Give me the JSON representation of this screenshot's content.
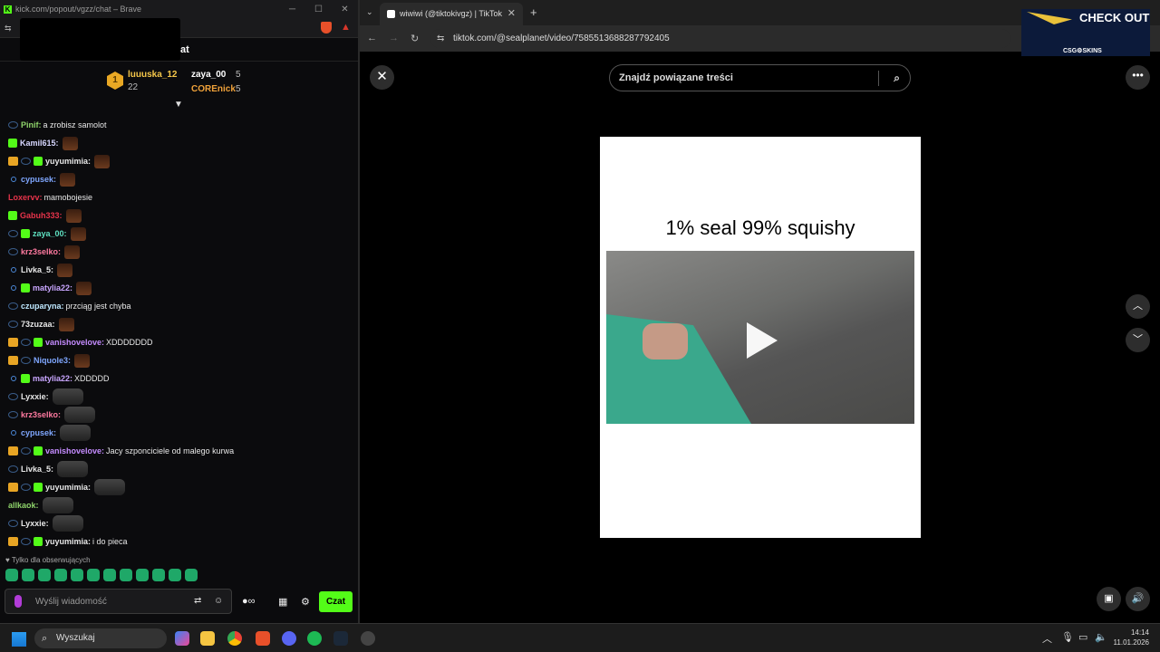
{
  "kick_window": {
    "title": "kick.com/popout/vgzz/chat – Brave",
    "chat_title_suffix": "at",
    "leaderboard": {
      "rank": "1",
      "first_user": "luuuska_12",
      "first_count": "22",
      "second_user": "zaya_00",
      "second_count": "5",
      "third_user": "COREnick",
      "third_count": "5"
    },
    "messages": [
      {
        "user": "Pinif",
        "color": "#8fd46b",
        "text": "a zrobisz samolot",
        "badges": [
          "sub"
        ]
      },
      {
        "user": "Kamil615",
        "color": "#d7d7ff",
        "text": "",
        "badges": [
          "green"
        ],
        "emote": true
      },
      {
        "user": "yuyumimia",
        "color": "#e8e8e8",
        "text": "",
        "badges": [
          "crown",
          "sub",
          "green"
        ],
        "emote": true
      },
      {
        "user": "cypusek",
        "color": "#7fa7ff",
        "text": "",
        "badges": [
          "dot"
        ],
        "emote": true
      },
      {
        "user": "Loxervv",
        "color": "#e6334a",
        "text": "mamobojesie",
        "badges": []
      },
      {
        "user": "Gabuh333",
        "color": "#e6334a",
        "text": "",
        "badges": [
          "green"
        ],
        "emote": true
      },
      {
        "user": "zaya_00",
        "color": "#5ee0c1",
        "text": "",
        "badges": [
          "sub",
          "green"
        ],
        "emote": true
      },
      {
        "user": "krz3selko",
        "color": "#ff7aa0",
        "text": "",
        "badges": [
          "sub"
        ],
        "emote": true
      },
      {
        "user": "Livka_5",
        "color": "#e8e8e8",
        "text": "",
        "badges": [
          "dot"
        ],
        "emote": true
      },
      {
        "user": "matylia22",
        "color": "#c9a6ff",
        "text": "",
        "badges": [
          "dot",
          "green"
        ],
        "emote": true
      },
      {
        "user": "czuparyna",
        "color": "#bfe8ff",
        "text": "przciąg jest chyba",
        "badges": [
          "sub"
        ]
      },
      {
        "user": "73zuzaa",
        "color": "#e8e8e8",
        "text": "",
        "badges": [
          "sub"
        ],
        "emote": true
      },
      {
        "user": "vanishovelove",
        "color": "#c58cff",
        "text": "XDDDDDDD",
        "badges": [
          "crown",
          "sub",
          "green"
        ]
      },
      {
        "user": "Niquole3",
        "color": "#7fa7ff",
        "text": "",
        "badges": [
          "crown",
          "sub"
        ],
        "emote": true
      },
      {
        "user": "matylia22",
        "color": "#c9a6ff",
        "text": "XDDDDD",
        "badges": [
          "dot",
          "green"
        ]
      },
      {
        "user": "Lyxxie",
        "color": "#e8e8e8",
        "text": "",
        "badges": [
          "sub"
        ],
        "emote_big": true
      },
      {
        "user": "krz3selko",
        "color": "#ff7aa0",
        "text": "",
        "badges": [
          "sub"
        ],
        "emote_big": true
      },
      {
        "user": "cypusek",
        "color": "#7fa7ff",
        "text": "",
        "badges": [
          "dot"
        ],
        "emote_big": true
      },
      {
        "user": "vanishovelove",
        "color": "#c58cff",
        "text": "Jacy szponciciele od malego kurwa",
        "badges": [
          "crown",
          "sub",
          "green"
        ]
      },
      {
        "user": "Livka_5",
        "color": "#e8e8e8",
        "text": "",
        "badges": [
          "sub"
        ],
        "emote_big": true
      },
      {
        "user": "yuyumimia",
        "color": "#e8e8e8",
        "text": "",
        "badges": [
          "crown",
          "sub",
          "green"
        ],
        "emote_big": true
      },
      {
        "user": "allkaok",
        "color": "#8fd46b",
        "text": "",
        "badges": [],
        "emote_big": true
      },
      {
        "user": "Lyxxie",
        "color": "#e8e8e8",
        "text": "",
        "badges": [
          "sub"
        ],
        "emote_big": true
      },
      {
        "user": "yuyumimia",
        "color": "#e8e8e8",
        "text": "i do pieca",
        "badges": [
          "crown",
          "sub",
          "green"
        ]
      }
    ],
    "followers_only": "Tylko dla obserwujących",
    "input_placeholder": "Wyślij wiadomość",
    "send_label": "Czat"
  },
  "tiktok_window": {
    "tab_title": "wiwiwi (@tiktokivgz) | TikTok",
    "url": "tiktok.com/@sealplanet/video/7585513688287792405",
    "search_placeholder": "Znajdź powiązane treści",
    "caption": "1% seal 99% squishy",
    "ad_title": "CHECK OUT",
    "ad_brand": "CSG⚙SKINS"
  },
  "taskbar": {
    "search_label": "Wyszukaj",
    "time": "14:14",
    "date": "11.01.2026"
  }
}
